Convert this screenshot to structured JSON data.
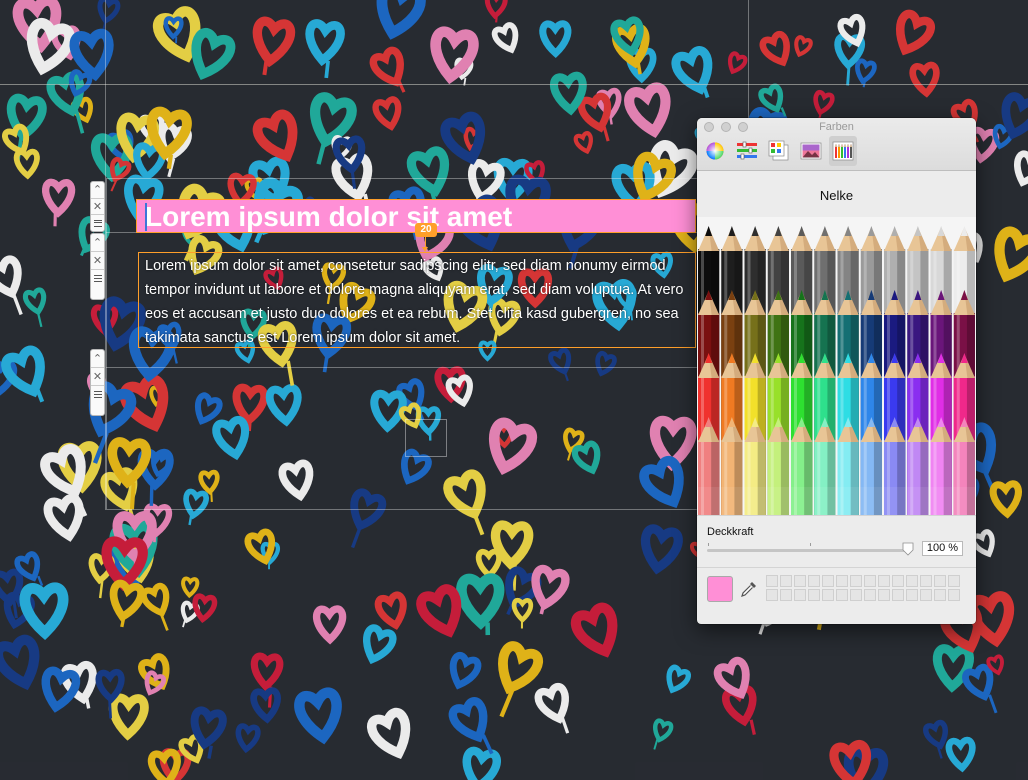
{
  "panel": {
    "title": "Farben",
    "selected_color_name": "Nelke",
    "opacity_label": "Deckkraft",
    "opacity_value": "100 %",
    "opacity_fraction": 1.0,
    "current_color": "#ff8fd6",
    "tools": [
      {
        "name": "color-wheel-icon"
      },
      {
        "name": "color-sliders-icon"
      },
      {
        "name": "color-palettes-icon"
      },
      {
        "name": "image-palettes-icon"
      },
      {
        "name": "pencils-icon",
        "active": true
      }
    ],
    "swatch_slots": 28
  },
  "editor": {
    "heading": "Lorem ipsum dolor sit amet",
    "heading_bg": "#ff8fd6",
    "selection_color": "#ff9f2a",
    "spacing_badge": "20",
    "body": "Lorem ipsum dolor sit amet, consetetur sadipscing elitr, sed diam nonumy eirmod tempor invidunt ut labore et dolore magna aliquyam erat, sed diam voluptua. At vero eos et accusam et justo duo dolores et ea rebum. Stet clita kasd gubergren, no sea takimata sanctus est Lorem ipsum dolor sit amet."
  },
  "pencil_rows": [
    [
      "#0d0d0d",
      "#1e1e1e",
      "#2e2e2e",
      "#424242",
      "#5a5a5a",
      "#6f6f6f",
      "#848484",
      "#9a9a9a",
      "#afafaf",
      "#c4c4c4",
      "#d8d8d8",
      "#ececec"
    ],
    [
      "#7a1010",
      "#7a4010",
      "#76701a",
      "#3f7314",
      "#16731b",
      "#157350",
      "#146f73",
      "#163b77",
      "#1a1a80",
      "#3a1780",
      "#6a157a",
      "#7a1046"
    ],
    [
      "#f0322e",
      "#f07a22",
      "#f2e02a",
      "#98e02a",
      "#2ee030",
      "#2ee08c",
      "#2edde4",
      "#2e86ea",
      "#3a3af0",
      "#8a2ef0",
      "#e02ee6",
      "#f0288a"
    ],
    [
      "#f08080",
      "#f2b474",
      "#f4ec84",
      "#c4f07c",
      "#84f08a",
      "#84f0c4",
      "#84ecf2",
      "#84b8f4",
      "#8a8af4",
      "#c088f4",
      "#f084f2",
      "#f484bc"
    ]
  ]
}
